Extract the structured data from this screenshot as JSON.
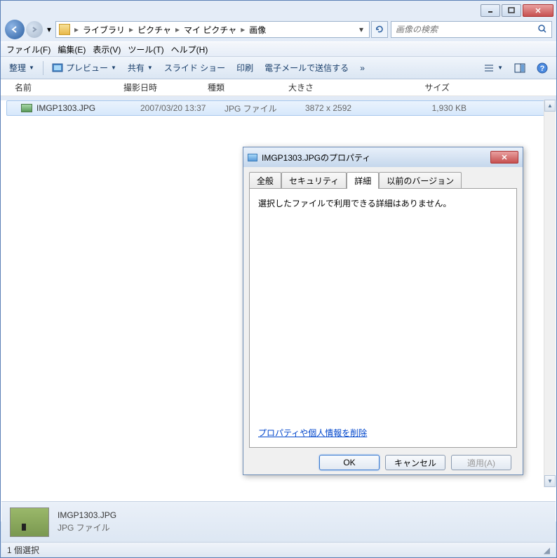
{
  "breadcrumb": {
    "segments": [
      "ライブラリ",
      "ピクチャ",
      "マイ ピクチャ",
      "画像"
    ]
  },
  "search": {
    "placeholder": "画像の検索"
  },
  "menubar": {
    "file": "ファイル(F)",
    "edit": "編集(E)",
    "view": "表示(V)",
    "tools": "ツール(T)",
    "help": "ヘルプ(H)"
  },
  "toolbar": {
    "organize": "整理",
    "preview": "プレビュー",
    "share": "共有",
    "slideshow": "スライド ショー",
    "print": "印刷",
    "email": "電子メールで送信する",
    "overflow": "»"
  },
  "columns": {
    "name": "名前",
    "date": "撮影日時",
    "type": "種類",
    "dimensions": "大きさ",
    "filesize": "サイズ"
  },
  "files": [
    {
      "name": "IMGP1303.JPG",
      "date": "2007/03/20 13:37",
      "type": "JPG ファイル",
      "dimensions": "3872 x 2592",
      "filesize": "1,930 KB"
    }
  ],
  "details": {
    "name": "IMGP1303.JPG",
    "type": "JPG ファイル"
  },
  "status": {
    "text": "1 個選択"
  },
  "dialog": {
    "title": "IMGP1303.JPGのプロパティ",
    "tabs": {
      "general": "全般",
      "security": "セキュリティ",
      "details": "詳細",
      "previous": "以前のバージョン"
    },
    "message": "選択したファイルで利用できる詳細はありません。",
    "link": "プロパティや個人情報を削除",
    "buttons": {
      "ok": "OK",
      "cancel": "キャンセル",
      "apply": "適用(A)"
    }
  }
}
